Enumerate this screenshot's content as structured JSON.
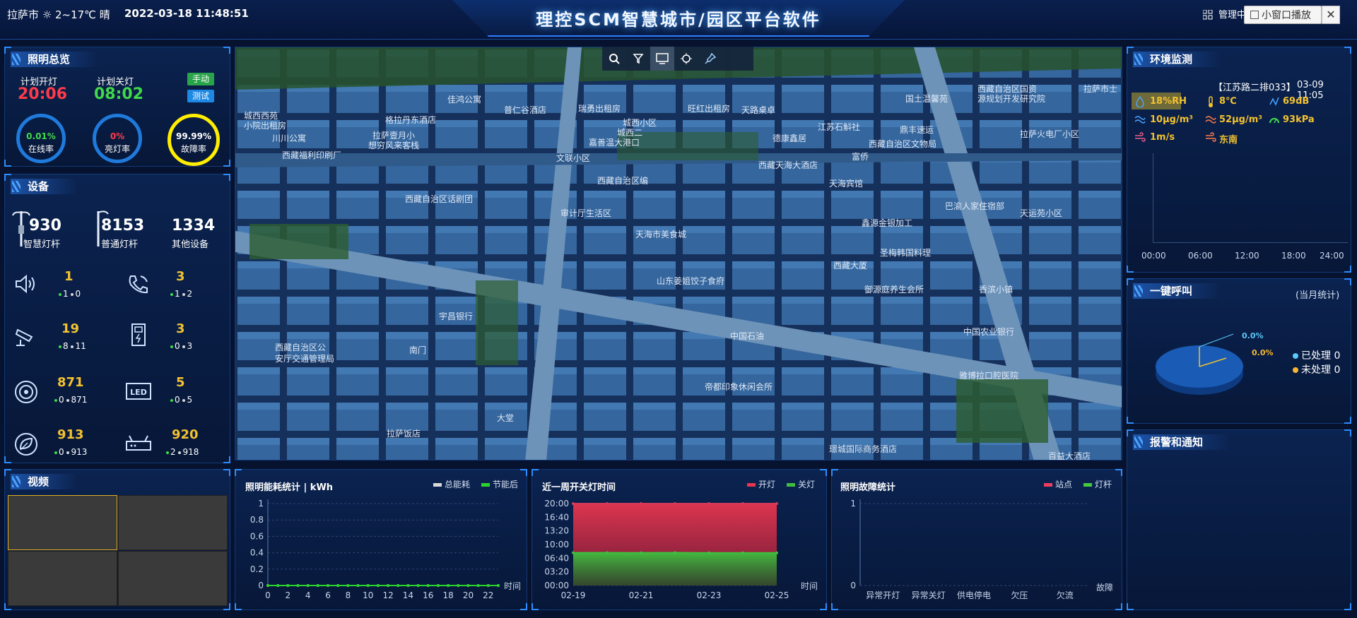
{
  "header": {
    "weather": "拉萨市 ☼ 2~17℃ 晴",
    "datetime": "2022-03-18 11:48:51",
    "title": "理控SCM智慧城市/园区平台软件",
    "manage": "管理中",
    "mini_play": "小窗口播放",
    "close": "✕"
  },
  "lighting": {
    "title": "照明总览",
    "plan_on_label": "计划开灯",
    "plan_on_time": "20:06",
    "plan_off_label": "计划关灯",
    "plan_off_time": "08:02",
    "mode_manual": "手动",
    "mode_test": "测试",
    "online_rate": "0.01%",
    "online_label": "在线率",
    "lit_rate": "0%",
    "lit_label": "亮灯率",
    "fault_rate": "99.99%",
    "fault_label": "故障率",
    "online_value": 0.0001,
    "lit_value": 0,
    "fault_value": 0.9999,
    "colors": {
      "on": "#ff3b4a",
      "off": "#41d84a",
      "fault_ring": "#ffee00",
      "ring": "#1f7adc"
    }
  },
  "devices": {
    "title": "设备",
    "smart_pole_count": "930",
    "smart_pole_label": "智慧灯杆",
    "normal_pole_count": "8153",
    "normal_pole_label": "普通灯杆",
    "other_count": "1334",
    "other_label": "其他设备",
    "items": [
      {
        "icon": "speaker-icon",
        "count": "1",
        "online": "1",
        "offline": "0"
      },
      {
        "icon": "phone-icon",
        "count": "3",
        "online": "1",
        "offline": "2"
      },
      {
        "icon": "camera-icon",
        "count": "19",
        "online": "8",
        "offline": "11"
      },
      {
        "icon": "charger-icon",
        "count": "3",
        "online": "0",
        "offline": "3"
      },
      {
        "icon": "sensor-icon",
        "count": "871",
        "online": "0",
        "offline": "871"
      },
      {
        "icon": "led-icon",
        "count": "5",
        "online": "0",
        "offline": "5"
      },
      {
        "icon": "leaf-icon",
        "count": "913",
        "online": "0",
        "offline": "913"
      },
      {
        "icon": "router-icon",
        "count": "920",
        "online": "2",
        "offline": "918"
      }
    ]
  },
  "video": {
    "title": "视频"
  },
  "map": {
    "toolbar": [
      "search-icon",
      "filter-icon",
      "screen-icon",
      "locate-icon",
      "pin-icon"
    ],
    "labels": [
      "佳鸿公寓",
      "普仁谷酒店",
      "瑞勇出租房",
      "城西西苑",
      "小院出租房",
      "格拉丹东酒店",
      "川川公寓",
      "拉萨壹月小",
      "想穷风来客栈",
      "西藏福利印刷厂",
      "城西二",
      "文联小区",
      "嘉善温大港口",
      "西藏自治区编",
      "西藏自治区话剧团",
      "审计厅生活区",
      "天海市美食城",
      "山东姜姐饺子食府",
      "宇昌银行",
      "南门",
      "西藏自治区公",
      "安厅交通管理局",
      "中国石油",
      "帝都印象休闲会所",
      "大堂",
      "拉萨饭店",
      "璟城国际商务酒店",
      "百益大酒店",
      "雅博拉口腔医院",
      "中国农业银行",
      "西藏大厦",
      "御源庭养生会所",
      "圣梅韩国料理",
      "鑫源金银加工",
      "巴渝人家住宿部",
      "天运苑小区",
      "拉萨火电厂小区",
      "国土温馨苑",
      "西藏自治区国资",
      "源规划开发研究院",
      "德康鑫居",
      "西藏天海大酒店",
      "天海宾馆",
      "鼎丰速运",
      "富侨",
      "西藏自治区文物局",
      "旺红出租房",
      "天路桌卓",
      "江苏石斛社",
      "城西小区",
      "香滨小镇",
      "拉萨市士"
    ]
  },
  "energy_chart": {
    "title": "照明能耗统计 | kWh",
    "legend": [
      "总能耗",
      "节能后"
    ],
    "xlabel": "时间",
    "chart_data": {
      "type": "line",
      "x": [
        0,
        1,
        2,
        3,
        4,
        5,
        6,
        7,
        8,
        9,
        10,
        11,
        12,
        13,
        14,
        15,
        16,
        17,
        18,
        19,
        20,
        21,
        22,
        23
      ],
      "xticks": [
        "0",
        "2",
        "4",
        "6",
        "8",
        "10",
        "12",
        "14",
        "16",
        "18",
        "20",
        "22"
      ],
      "yticks": [
        "0",
        "0.2",
        "0.4",
        "0.6",
        "0.8",
        "1"
      ],
      "ylim": [
        0,
        1
      ],
      "series": [
        {
          "name": "总能耗",
          "values": [
            0,
            0,
            0,
            0,
            0,
            0,
            0,
            0,
            0,
            0,
            0,
            0,
            0,
            0,
            0,
            0,
            0,
            0,
            0,
            0,
            0,
            0,
            0,
            0
          ],
          "color": "#d9d9d9"
        },
        {
          "name": "节能后",
          "values": [
            0,
            0,
            0,
            0,
            0,
            0,
            0,
            0,
            0,
            0,
            0,
            0,
            0,
            0,
            0,
            0,
            0,
            0,
            0,
            0,
            0,
            0,
            0,
            0
          ],
          "color": "#2ad42a"
        }
      ]
    }
  },
  "onoff_chart": {
    "title": "近一周开关灯时间",
    "legend": [
      "开灯",
      "关灯"
    ],
    "xlabel": "时间",
    "chart_data": {
      "type": "area",
      "x": [
        "02-19",
        "02-20",
        "02-21",
        "02-22",
        "02-23",
        "02-24",
        "02-25"
      ],
      "xticks": [
        "02-19",
        "02-21",
        "02-23",
        "02-25"
      ],
      "yticks": [
        "00:00",
        "03:20",
        "06:40",
        "10:00",
        "13:20",
        "16:40",
        "20:00"
      ],
      "ylim_minutes": [
        0,
        1200
      ],
      "series": [
        {
          "name": "开灯",
          "values": [
            1200,
            1200,
            1200,
            1200,
            1200,
            1200,
            1200
          ],
          "color": "#d63a5a"
        },
        {
          "name": "关灯",
          "values": [
            480,
            481,
            480,
            481,
            478,
            478,
            478
          ],
          "color": "#3fbf3f"
        }
      ]
    }
  },
  "fault_chart": {
    "title": "照明故障统计",
    "legend": [
      "站点",
      "灯杆"
    ],
    "xlabel": "故障",
    "chart_data": {
      "type": "bar",
      "categories": [
        "异常开灯",
        "异常关灯",
        "供电停电",
        "欠压",
        "欠流"
      ],
      "yticks": [
        "0",
        "1"
      ],
      "ylim": [
        0,
        1
      ],
      "series": [
        {
          "name": "站点",
          "values": [
            0,
            0,
            0,
            0,
            0
          ],
          "color": "#ef3d5f"
        },
        {
          "name": "灯杆",
          "values": [
            0,
            0,
            0,
            0,
            0
          ],
          "color": "#45c93d"
        }
      ]
    }
  },
  "env": {
    "title": "环境监测",
    "location": "【江苏路二排033】",
    "time": "03-09 11:05",
    "humidity": "18%RH",
    "temperature": "8℃",
    "noise": "69dB",
    "pm10": "10μg/m³",
    "pm25": "52μg/m³",
    "pressure": "93kPa",
    "wind_speed": "1m/s",
    "wind_dir": "东南",
    "xticks": [
      "00:00",
      "06:00",
      "12:00",
      "18:00",
      "24:00"
    ]
  },
  "call": {
    "title": "一键呼叫",
    "period": "(当月统计)",
    "pct1": "0.0%",
    "pct2": "0.0%",
    "handled_label": "已处理",
    "handled_value": "0",
    "unhandled_label": "未处理",
    "unhandled_value": "0",
    "colors": {
      "handled": "#5ac8fa",
      "unhandled": "#f7b733"
    }
  },
  "alarm": {
    "title": "报警和通知"
  }
}
